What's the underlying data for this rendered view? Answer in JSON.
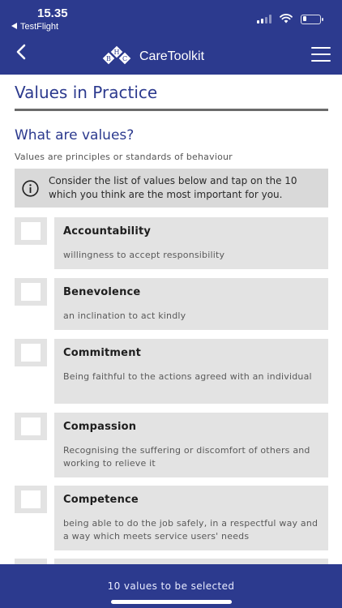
{
  "status_bar": {
    "time": "15.35",
    "back_app_label": "TestFlight",
    "back_app_icon": "small-left-triangle-icon",
    "icons": [
      "signal-icon",
      "wifi-icon",
      "battery-icon"
    ]
  },
  "app_bar": {
    "title": "CareToolkit",
    "logo_letters": [
      "B",
      "H",
      "C"
    ],
    "icons": [
      "back-chevron-icon",
      "hamburger-menu-icon"
    ]
  },
  "page": {
    "title": "Values in Practice",
    "section_title": "What are values?",
    "subtitle": "Values are principles or standards of behaviour",
    "info_text": "Consider the list of values below and tap on the 10 which you think are the most important for you.",
    "info_icon": "info-circle-icon"
  },
  "values": [
    {
      "name": "Accountability",
      "description": "willingness to accept responsibility",
      "selected": false
    },
    {
      "name": "Benevolence",
      "description": "an inclination to act kindly",
      "selected": false
    },
    {
      "name": "Commitment",
      "description": "Being faithful to the actions agreed with an individual",
      "selected": false
    },
    {
      "name": "Compassion",
      "description": "Recognising the suffering or discomfort of others and working to relieve it",
      "selected": false
    },
    {
      "name": "Competence",
      "description": "being able to do the job safely, in a respectful way and a way which meets service users' needs",
      "selected": false
    }
  ],
  "footer": {
    "label": "10 values to be selected"
  },
  "colors": {
    "brand": "#2c3a8e",
    "card": "#e3e3e3",
    "info_box": "#d9d9d9",
    "rule": "#6b6b6b"
  }
}
